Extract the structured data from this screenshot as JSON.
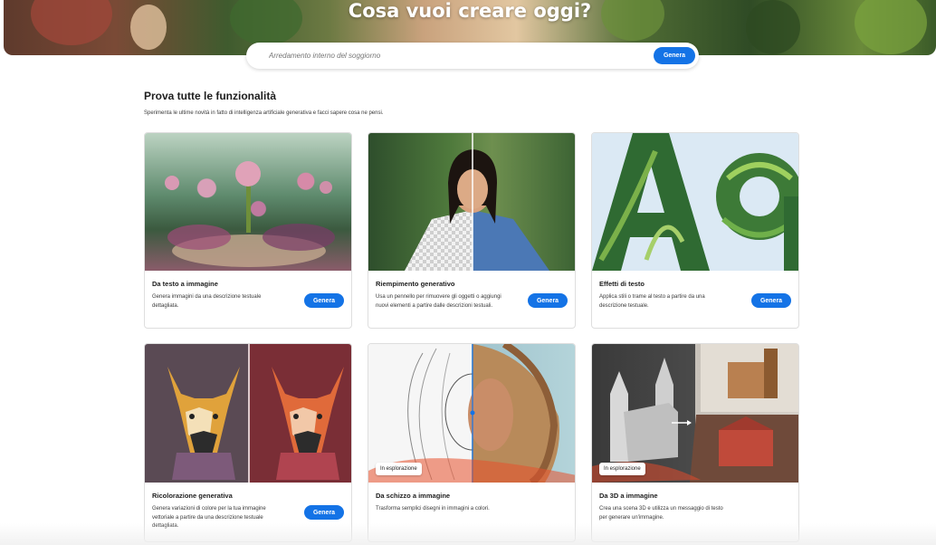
{
  "hero": {
    "title": "Cosa vuoi creare oggi?",
    "search_placeholder": "Arredamento interno del soggiorno",
    "search_button": "Genera"
  },
  "section": {
    "title": "Prova tutte le funzionalità",
    "subtitle": "Sperimenta le ultime novità in fatto di intelligenza artificiale generativa e facci sapere cosa ne pensi."
  },
  "cards": [
    {
      "title": "Da testo a immagine",
      "desc": "Genera immagini da una descrizione testuale dettagliata.",
      "button": "Genera",
      "image": "fantasy-garden-image"
    },
    {
      "title": "Riempimento generativo",
      "desc": "Usa un pennello per rimuovere gli oggetti o aggiungi nuovi elementi a partire dalle descrizioni testuali.",
      "button": "Genera",
      "image": "woman-portrait-image"
    },
    {
      "title": "Effetti di testo",
      "desc": "Applica stili o trame al testo a partire da una descrizione testuale.",
      "button": "Genera",
      "image": "leaf-letters-image"
    },
    {
      "title": "Ricolorazione generativa",
      "desc": "Genera variazioni di colore per la tua immagine vettoriale a partire da una descrizione testuale dettagliata.",
      "button": "Genera",
      "image": "dog-vector-image"
    },
    {
      "title": "Da schizzo a immagine",
      "desc": "Trasforma semplici disegni in immagini a colori.",
      "badge": "In esplorazione",
      "image": "sketch-face-image"
    },
    {
      "title": "Da 3D a immagine",
      "desc": "Crea una scena 3D e utilizza un messaggio di testo per generare un'immagine.",
      "badge": "In esplorazione",
      "image": "castle-3d-image"
    }
  ],
  "colors": {
    "accent": "#1473e6"
  }
}
